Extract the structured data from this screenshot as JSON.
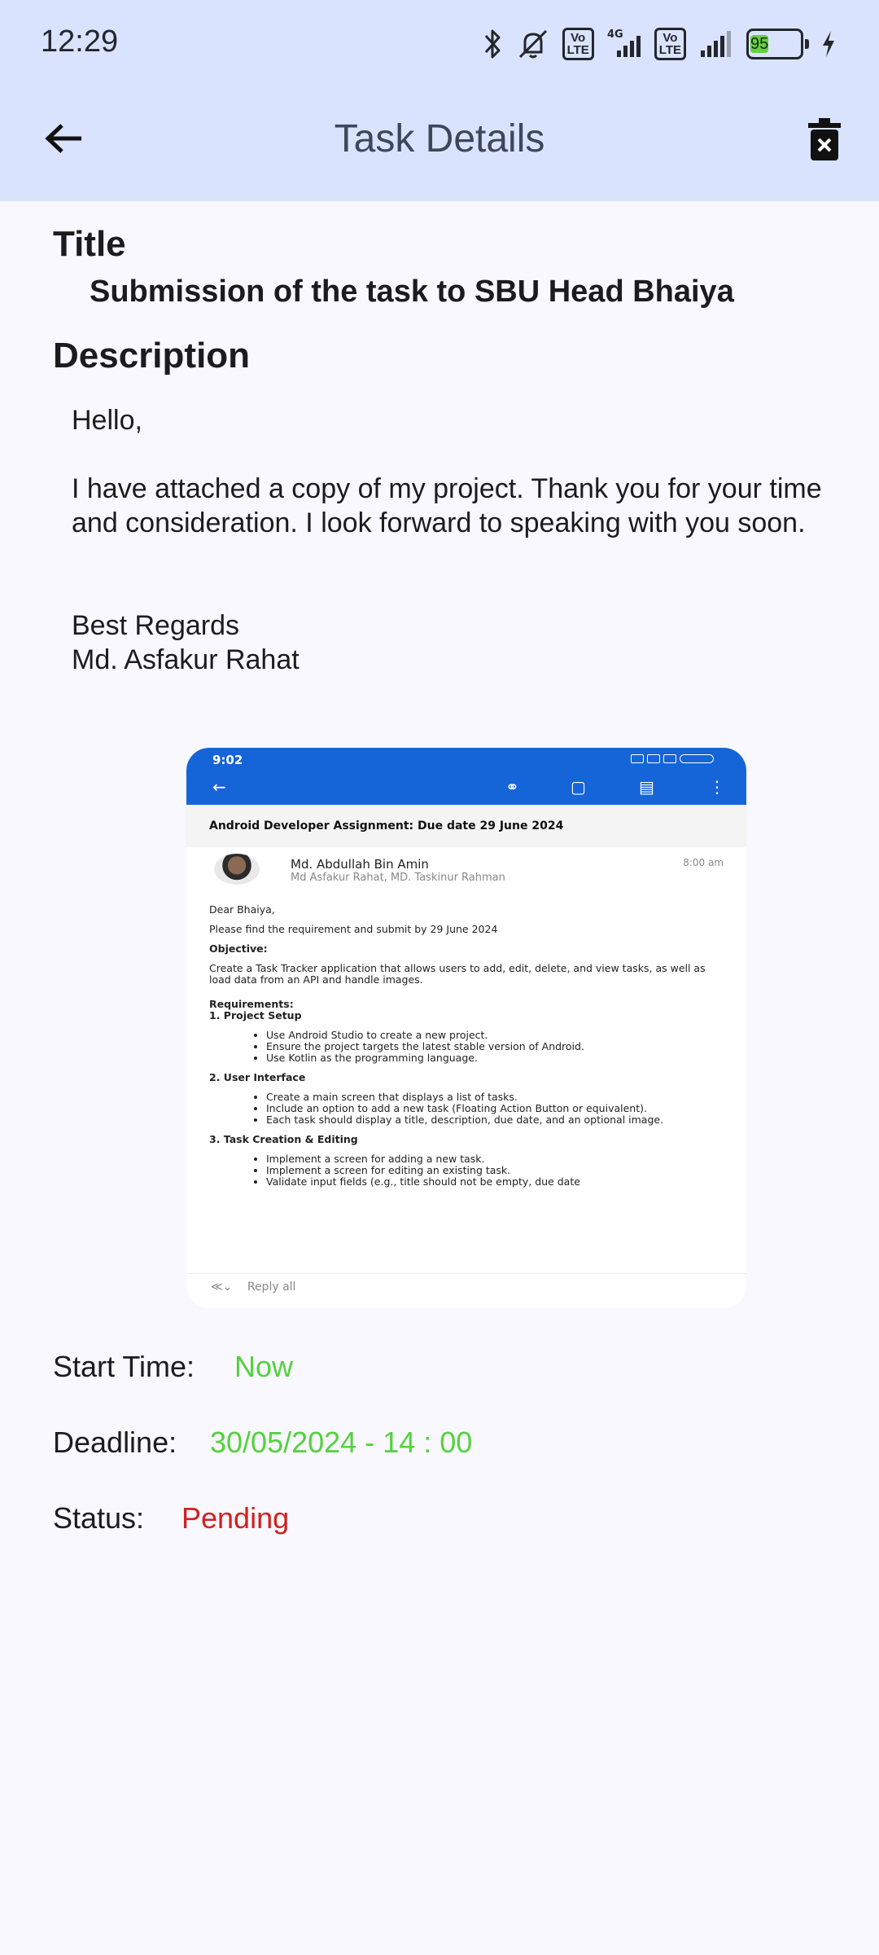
{
  "status_bar": {
    "time": "12:29",
    "volte_label": "Vo\nLTE",
    "network_label": "4G",
    "battery": "95",
    "icons": [
      "bluetooth-icon",
      "silent-icon",
      "volte-icon",
      "signal-icon",
      "battery-icon",
      "charging-icon"
    ]
  },
  "header": {
    "title": "Task Details",
    "back_icon": "arrow-left-icon",
    "delete_icon": "delete-icon"
  },
  "task": {
    "title_label": "Title",
    "title": "Submission of the task to SBU Head Bhaiya",
    "description_label": "Description",
    "description": {
      "greeting": "Hello,",
      "body": "I have attached a copy of my project. Thank you for your time and consideration. I look forward to speaking with you soon.",
      "closing": "Best Regards",
      "name": "Md. Asfakur Rahat"
    },
    "start_label": "Start Time:",
    "start_value": "Now",
    "deadline_label": "Deadline:",
    "deadline_value": "30/05/2024 - 14 : 00",
    "status_label": "Status:",
    "status_value": "Pending"
  },
  "attachment": {
    "time": "9:02",
    "subject": "Android Developer Assignment: Due date 29 June 2024",
    "sender": "Md. Abdullah Bin Amin",
    "recipients": "Md Asfakur Rahat, MD. Taskinur Rahman",
    "sent_time": "8:00 am",
    "greeting": "Dear Bhaiya,",
    "intro": "Please find the requirement and submit by 29 June 2024",
    "objective_label": "Objective:",
    "objective": "Create a Task Tracker application that allows users to add, edit, delete, and view tasks, as well as load data from an API and handle images.",
    "requirements_label": "Requirements:",
    "section1": "1. Project Setup",
    "s1_items": [
      "Use Android Studio to create a new project.",
      "Ensure the project targets the latest stable version of Android.",
      "Use Kotlin as the programming language."
    ],
    "section2": "2. User Interface",
    "s2_items": [
      "Create a main screen that displays a list of tasks.",
      "Include an option to add a new task (Floating Action Button or equivalent).",
      "Each task should display a title, description, due date, and an optional image."
    ],
    "section3": "3. Task Creation & Editing",
    "s3_items": [
      "Implement a screen for adding a new task.",
      "Implement a screen for editing an existing task.",
      "Validate input fields (e.g., title should not be empty, due date"
    ],
    "reply_label": "Reply all"
  }
}
